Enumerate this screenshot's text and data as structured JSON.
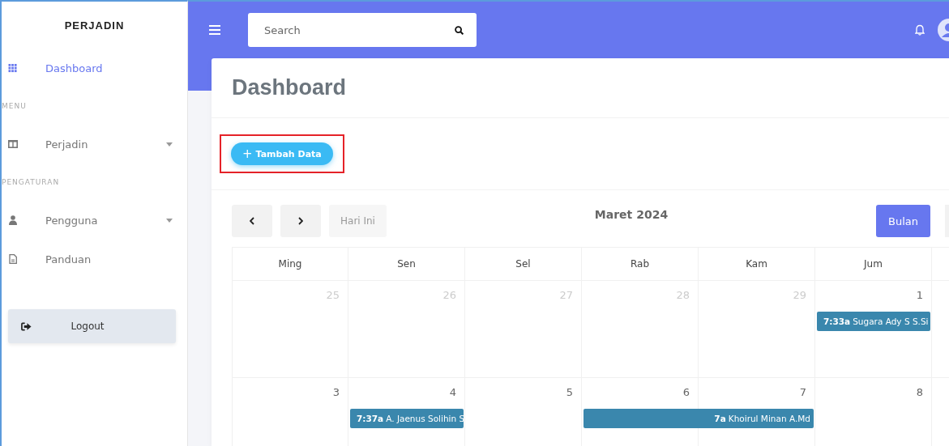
{
  "sidebar": {
    "brand": "PERJADIN",
    "items": [
      {
        "kind": "link",
        "label": "Dashboard",
        "selected": true,
        "has_caret": false
      },
      {
        "kind": "heading",
        "label": "MENU"
      },
      {
        "kind": "link",
        "label": "Perjadin",
        "selected": false,
        "has_caret": true
      },
      {
        "kind": "heading",
        "label": "PENGATURAN"
      },
      {
        "kind": "link",
        "label": "Pengguna",
        "selected": false,
        "has_caret": true
      },
      {
        "kind": "link",
        "label": "Panduan",
        "selected": false,
        "has_caret": false
      }
    ],
    "logout": "Logout"
  },
  "topbar": {
    "search": {
      "placeholder": "Search"
    }
  },
  "page": {
    "title": "Dashboard",
    "add_button": {
      "icon": "+",
      "label": "Tambah Data"
    },
    "add_button_highlighted": true
  },
  "calendar": {
    "title": "Maret 2024",
    "today_button": "Hari Ini",
    "views": [
      {
        "label": "Bulan",
        "selected": true
      }
    ],
    "days": [
      "Ming",
      "Sen",
      "Sel",
      "Rab",
      "Kam",
      "Jum"
    ],
    "weeks": [
      {
        "dates": [
          {
            "label": "25",
            "other_month": true
          },
          {
            "label": "26",
            "other_month": true
          },
          {
            "label": "27",
            "other_month": true
          },
          {
            "label": "28",
            "other_month": true
          },
          {
            "label": "29",
            "other_month": true
          },
          {
            "label": "1",
            "other_month": false,
            "events": [
              {
                "time": "7:33a",
                "title": "Sugara Ady S S.Si",
                "continues_next_day": false
              }
            ]
          }
        ]
      },
      {
        "dates": [
          {
            "label": "3",
            "other_month": false
          },
          {
            "label": "4",
            "other_month": false,
            "events": [
              {
                "time": "7:37a",
                "title": "A. Jaenus Solihin S",
                "continues_next_day": false
              }
            ]
          },
          {
            "label": "5",
            "other_month": false
          },
          {
            "label": "6",
            "other_month": false,
            "events": [
              {
                "time": "7a",
                "title": "Khoirul Minan A.Md",
                "continues_next_day": true
              }
            ]
          },
          {
            "label": "7",
            "other_month": false
          },
          {
            "label": "8",
            "other_month": false
          }
        ]
      }
    ]
  }
}
